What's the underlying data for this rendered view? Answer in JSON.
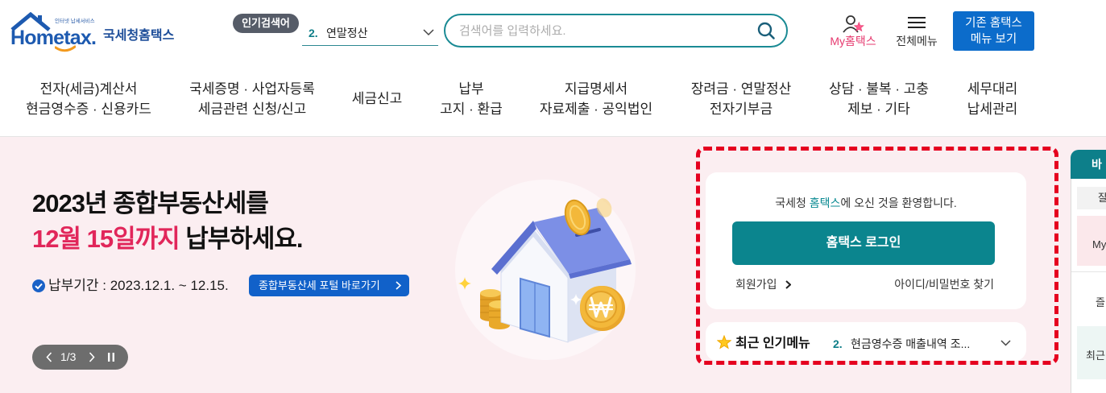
{
  "header": {
    "logo": {
      "tagline": "인터넷 납세서비스",
      "brand": "Hometax.",
      "subtitle": "국세청홈택스"
    },
    "popular_search": {
      "label": "인기검색어",
      "rank": "2.",
      "term": "연말정산",
      "icon": "chevron-down-icon"
    },
    "search": {
      "placeholder": "검색어를 입력하세요.",
      "icon": "search-icon"
    },
    "my_hometax": {
      "label": "My홈택스",
      "icon": "user-star-icon"
    },
    "all_menu": {
      "label": "전체메뉴",
      "icon": "hamburger-menu-icon"
    },
    "legacy_menu": {
      "line1": "기존 홈택스",
      "line2": "메뉴 보기"
    }
  },
  "nav": [
    {
      "line1": "전자(세금)계산서",
      "line2": "현금영수증 · 신용카드"
    },
    {
      "line1": "국세증명 · 사업자등록",
      "line2": "세금관련 신청/신고"
    },
    {
      "line1": "세금신고"
    },
    {
      "line1": "납부",
      "line2": "고지 · 환급"
    },
    {
      "line1": "지급명세서",
      "line2": "자료제출 · 공익법인"
    },
    {
      "line1": "장려금 · 연말정산",
      "line2": "전자기부금"
    },
    {
      "line1": "상담 · 불복 · 고충",
      "line2": "제보 · 기타"
    },
    {
      "line1": "세무대리",
      "line2": "납세관리"
    }
  ],
  "banner": {
    "title_line1": "2023년 종합부동산세를",
    "title_highlight": "12월 15일까지",
    "title_rest": " 납부하세요.",
    "period": "납부기간 : 2023.12.1. ~ 12.15.",
    "portal_button": "종합부동산세 포털 바로가기",
    "pager": {
      "label": "1/3"
    }
  },
  "login": {
    "welcome_prefix": "국세청 ",
    "welcome_brand": "홈택스",
    "welcome_suffix": "에 오신 것을 환영합니다.",
    "login_button": "홈택스 로그인",
    "signup": "회원가입",
    "find_account": "아이디/비밀번호 찾기"
  },
  "popular_menu": {
    "title": "최근 인기메뉴",
    "rank": "2.",
    "item": "현금영수증 매출내역 조..."
  },
  "quick_menu": {
    "header": "바",
    "items": [
      "잘",
      "My",
      "즐",
      "최근"
    ]
  },
  "colors": {
    "brand_blue": "#1d5ab0",
    "teal": "#0b858e",
    "highlight_red": "#e1265a",
    "banner_bg": "#fbeef1",
    "legacy_button": "#0c6ccb",
    "portal_button": "#1161c9",
    "my_hometax_pink": "#e63a6f",
    "dashed_outline_red": "#e5001f"
  }
}
